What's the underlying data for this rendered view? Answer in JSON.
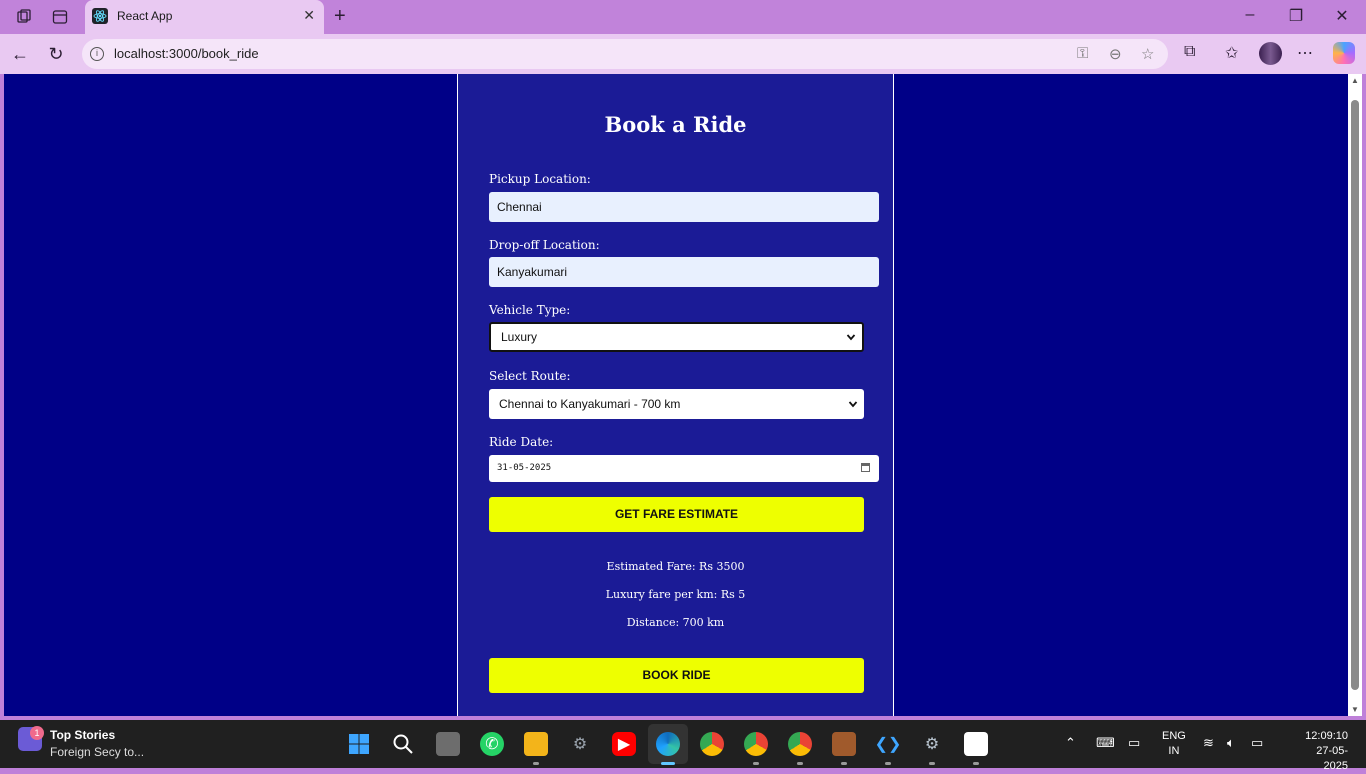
{
  "browser": {
    "tab_title": "React App",
    "url": "localhost:3000/book_ride"
  },
  "form": {
    "heading": "Book a Ride",
    "pickup_label": "Pickup Location:",
    "pickup_value": "Chennai",
    "dropoff_label": "Drop-off Location:",
    "dropoff_value": "Kanyakumari",
    "vehicle_label": "Vehicle Type:",
    "vehicle_value": "Luxury",
    "route_label": "Select Route:",
    "route_value": "Chennai to Kanyakumari - 700 km",
    "date_label": "Ride Date:",
    "date_value": "31-05-2025",
    "estimate_button": "GET FARE ESTIMATE",
    "estimated_fare": "Estimated Fare: Rs 3500",
    "fare_per_km": "Luxury fare per km: Rs 5",
    "distance": "Distance: 700 km",
    "book_button": "BOOK RIDE"
  },
  "taskbar": {
    "news_badge": "1",
    "news_title": "Top Stories",
    "news_sub": "Foreign Secy to...",
    "lang_top": "ENG",
    "lang_bottom": "IN",
    "time": "12:09:10",
    "date": "27-05-2025"
  },
  "colors": {
    "page_bg": "#000087",
    "card_bg": "#1b1b96",
    "button_bg": "#eeff00",
    "browser_frame": "#bf80d9"
  },
  "icons": [
    "workspaces-icon",
    "tab-actions-icon",
    "react-favicon-icon",
    "close-tab-icon",
    "new-tab-icon",
    "minimize-icon",
    "restore-icon",
    "close-window-icon",
    "back-icon",
    "refresh-icon",
    "site-info-icon",
    "key-icon",
    "zoom-icon",
    "favorite-star-icon",
    "extensions-icon",
    "favorites-icon",
    "profile-avatar",
    "more-icon",
    "copilot-icon",
    "dropdown-chevron-icon",
    "calendar-icon"
  ]
}
